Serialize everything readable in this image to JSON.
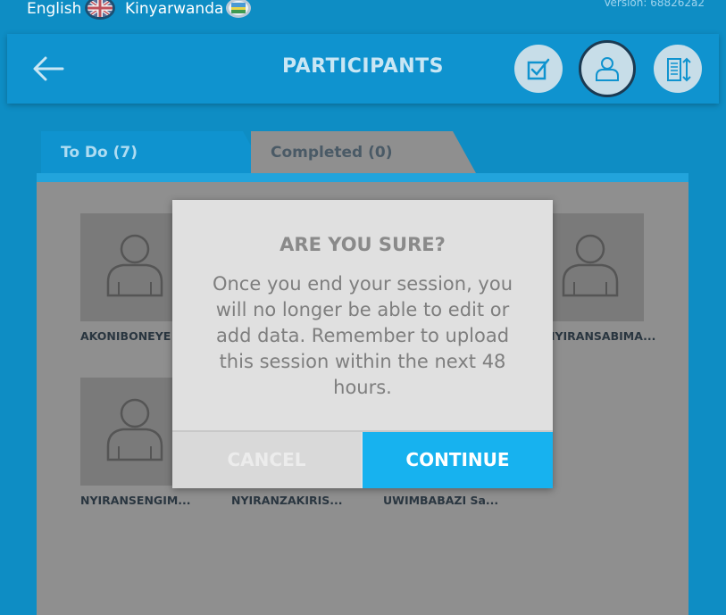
{
  "languages": {
    "english_label": "English",
    "kinyarwanda_label": "Kinyarwanda"
  },
  "version": "Version: 688262a2",
  "header": {
    "title": "PARTICIPANTS"
  },
  "tabs": [
    {
      "label": "To Do (7)",
      "active": true
    },
    {
      "label": "Completed (0)",
      "active": false
    }
  ],
  "participants": [
    {
      "name": "AKONIBONEYE ..."
    },
    {
      "name": "NYIRANSABIMA..."
    },
    {
      "name": "NYIRANSENGIM..."
    },
    {
      "name": "NYIRANZAKIRIS..."
    },
    {
      "name": "UWIMBABAZI Sa..."
    }
  ],
  "dialog": {
    "title": "ARE YOU SURE?",
    "message": "Once you end your session, you will no longer be able to edit or add data. Remember to upload this session within the next 48 hours.",
    "cancel_label": "CANCEL",
    "continue_label": "CONTINUE"
  },
  "colors": {
    "background": "#0e8dc4",
    "header": "#0f93cf",
    "accent": "#17b2ef",
    "overlay_content": "#8f8f8f"
  }
}
